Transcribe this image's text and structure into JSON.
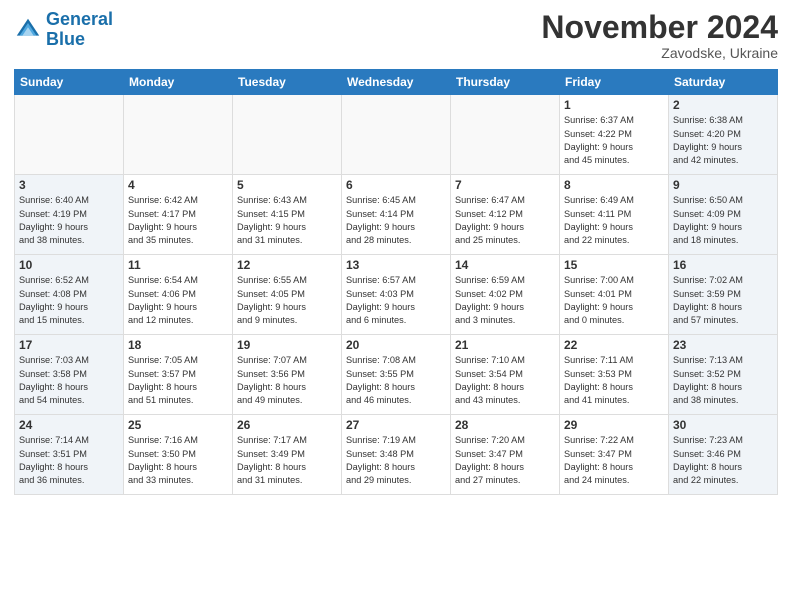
{
  "logo": {
    "line1": "General",
    "line2": "Blue"
  },
  "title": "November 2024",
  "location": "Zavodske, Ukraine",
  "days_of_week": [
    "Sunday",
    "Monday",
    "Tuesday",
    "Wednesday",
    "Thursday",
    "Friday",
    "Saturday"
  ],
  "weeks": [
    [
      {
        "day": "",
        "info": "",
        "type": "empty"
      },
      {
        "day": "",
        "info": "",
        "type": "empty"
      },
      {
        "day": "",
        "info": "",
        "type": "empty"
      },
      {
        "day": "",
        "info": "",
        "type": "empty"
      },
      {
        "day": "",
        "info": "",
        "type": "empty"
      },
      {
        "day": "1",
        "info": "Sunrise: 6:37 AM\nSunset: 4:22 PM\nDaylight: 9 hours\nand 45 minutes.",
        "type": "normal"
      },
      {
        "day": "2",
        "info": "Sunrise: 6:38 AM\nSunset: 4:20 PM\nDaylight: 9 hours\nand 42 minutes.",
        "type": "saturday"
      }
    ],
    [
      {
        "day": "3",
        "info": "Sunrise: 6:40 AM\nSunset: 4:19 PM\nDaylight: 9 hours\nand 38 minutes.",
        "type": "sunday"
      },
      {
        "day": "4",
        "info": "Sunrise: 6:42 AM\nSunset: 4:17 PM\nDaylight: 9 hours\nand 35 minutes.",
        "type": "normal"
      },
      {
        "day": "5",
        "info": "Sunrise: 6:43 AM\nSunset: 4:15 PM\nDaylight: 9 hours\nand 31 minutes.",
        "type": "normal"
      },
      {
        "day": "6",
        "info": "Sunrise: 6:45 AM\nSunset: 4:14 PM\nDaylight: 9 hours\nand 28 minutes.",
        "type": "normal"
      },
      {
        "day": "7",
        "info": "Sunrise: 6:47 AM\nSunset: 4:12 PM\nDaylight: 9 hours\nand 25 minutes.",
        "type": "normal"
      },
      {
        "day": "8",
        "info": "Sunrise: 6:49 AM\nSunset: 4:11 PM\nDaylight: 9 hours\nand 22 minutes.",
        "type": "normal"
      },
      {
        "day": "9",
        "info": "Sunrise: 6:50 AM\nSunset: 4:09 PM\nDaylight: 9 hours\nand 18 minutes.",
        "type": "saturday"
      }
    ],
    [
      {
        "day": "10",
        "info": "Sunrise: 6:52 AM\nSunset: 4:08 PM\nDaylight: 9 hours\nand 15 minutes.",
        "type": "sunday"
      },
      {
        "day": "11",
        "info": "Sunrise: 6:54 AM\nSunset: 4:06 PM\nDaylight: 9 hours\nand 12 minutes.",
        "type": "normal"
      },
      {
        "day": "12",
        "info": "Sunrise: 6:55 AM\nSunset: 4:05 PM\nDaylight: 9 hours\nand 9 minutes.",
        "type": "normal"
      },
      {
        "day": "13",
        "info": "Sunrise: 6:57 AM\nSunset: 4:03 PM\nDaylight: 9 hours\nand 6 minutes.",
        "type": "normal"
      },
      {
        "day": "14",
        "info": "Sunrise: 6:59 AM\nSunset: 4:02 PM\nDaylight: 9 hours\nand 3 minutes.",
        "type": "normal"
      },
      {
        "day": "15",
        "info": "Sunrise: 7:00 AM\nSunset: 4:01 PM\nDaylight: 9 hours\nand 0 minutes.",
        "type": "normal"
      },
      {
        "day": "16",
        "info": "Sunrise: 7:02 AM\nSunset: 3:59 PM\nDaylight: 8 hours\nand 57 minutes.",
        "type": "saturday"
      }
    ],
    [
      {
        "day": "17",
        "info": "Sunrise: 7:03 AM\nSunset: 3:58 PM\nDaylight: 8 hours\nand 54 minutes.",
        "type": "sunday"
      },
      {
        "day": "18",
        "info": "Sunrise: 7:05 AM\nSunset: 3:57 PM\nDaylight: 8 hours\nand 51 minutes.",
        "type": "normal"
      },
      {
        "day": "19",
        "info": "Sunrise: 7:07 AM\nSunset: 3:56 PM\nDaylight: 8 hours\nand 49 minutes.",
        "type": "normal"
      },
      {
        "day": "20",
        "info": "Sunrise: 7:08 AM\nSunset: 3:55 PM\nDaylight: 8 hours\nand 46 minutes.",
        "type": "normal"
      },
      {
        "day": "21",
        "info": "Sunrise: 7:10 AM\nSunset: 3:54 PM\nDaylight: 8 hours\nand 43 minutes.",
        "type": "normal"
      },
      {
        "day": "22",
        "info": "Sunrise: 7:11 AM\nSunset: 3:53 PM\nDaylight: 8 hours\nand 41 minutes.",
        "type": "normal"
      },
      {
        "day": "23",
        "info": "Sunrise: 7:13 AM\nSunset: 3:52 PM\nDaylight: 8 hours\nand 38 minutes.",
        "type": "saturday"
      }
    ],
    [
      {
        "day": "24",
        "info": "Sunrise: 7:14 AM\nSunset: 3:51 PM\nDaylight: 8 hours\nand 36 minutes.",
        "type": "sunday"
      },
      {
        "day": "25",
        "info": "Sunrise: 7:16 AM\nSunset: 3:50 PM\nDaylight: 8 hours\nand 33 minutes.",
        "type": "normal"
      },
      {
        "day": "26",
        "info": "Sunrise: 7:17 AM\nSunset: 3:49 PM\nDaylight: 8 hours\nand 31 minutes.",
        "type": "normal"
      },
      {
        "day": "27",
        "info": "Sunrise: 7:19 AM\nSunset: 3:48 PM\nDaylight: 8 hours\nand 29 minutes.",
        "type": "normal"
      },
      {
        "day": "28",
        "info": "Sunrise: 7:20 AM\nSunset: 3:47 PM\nDaylight: 8 hours\nand 27 minutes.",
        "type": "normal"
      },
      {
        "day": "29",
        "info": "Sunrise: 7:22 AM\nSunset: 3:47 PM\nDaylight: 8 hours\nand 24 minutes.",
        "type": "normal"
      },
      {
        "day": "30",
        "info": "Sunrise: 7:23 AM\nSunset: 3:46 PM\nDaylight: 8 hours\nand 22 minutes.",
        "type": "saturday"
      }
    ]
  ]
}
